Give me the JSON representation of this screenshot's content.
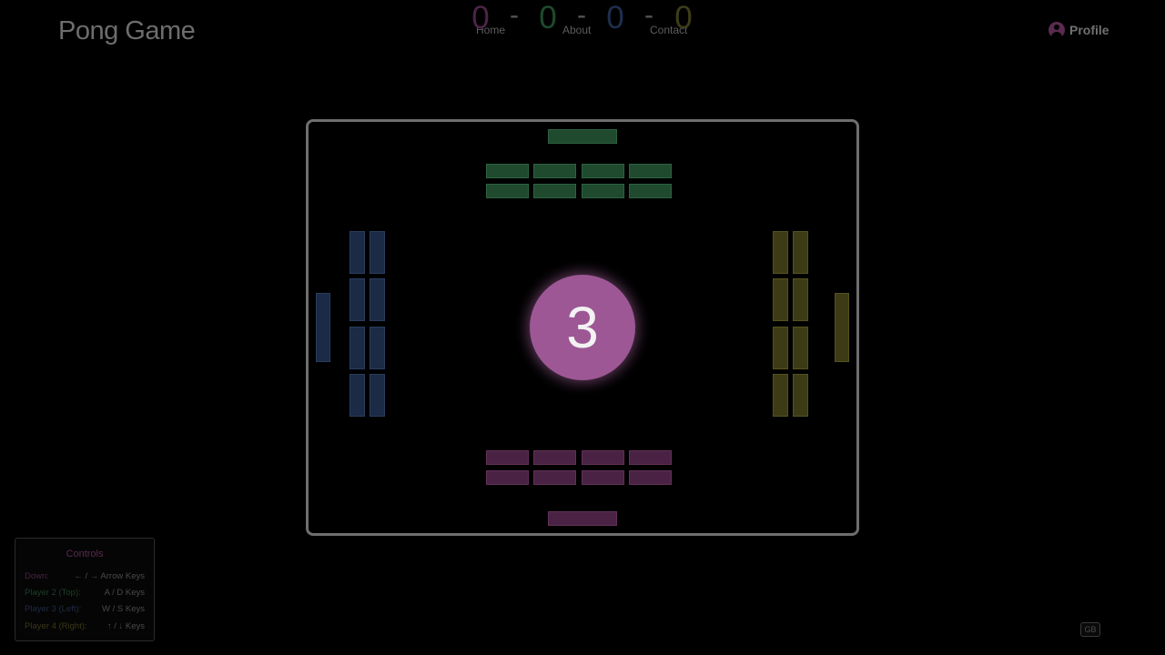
{
  "header": {
    "title": "Pong Game",
    "nav": [
      {
        "label": "Home"
      },
      {
        "label": "About"
      },
      {
        "label": "Contact"
      }
    ],
    "profile_label": "Profile"
  },
  "score": {
    "values": [
      "0",
      "0",
      "0",
      "0"
    ],
    "separator": "-",
    "colors": [
      "#4d2447",
      "#1f4a2e",
      "#1e2f4d",
      "#3d3d1a"
    ]
  },
  "board": {
    "countdown": "3",
    "team_colors": {
      "top": "#1f4a2e",
      "bottom": "#4a2344",
      "left": "#1b2a45",
      "right": "#3d3b15"
    }
  },
  "controls": {
    "title": "Controls",
    "rows": [
      {
        "label": "Down:",
        "keys": "← / → Arrow Keys",
        "color": "#4a2244"
      },
      {
        "label": "Player 2 (Top):",
        "keys": "A / D Keys",
        "color": "#1f3f2a"
      },
      {
        "label": "Player 3 (Left):",
        "keys": "W / S Keys",
        "color": "#1f2c44"
      },
      {
        "label": "Player 4 (Right):",
        "keys": "↑ / ↓ Keys",
        "color": "#3a3718"
      }
    ]
  },
  "language": "GB"
}
